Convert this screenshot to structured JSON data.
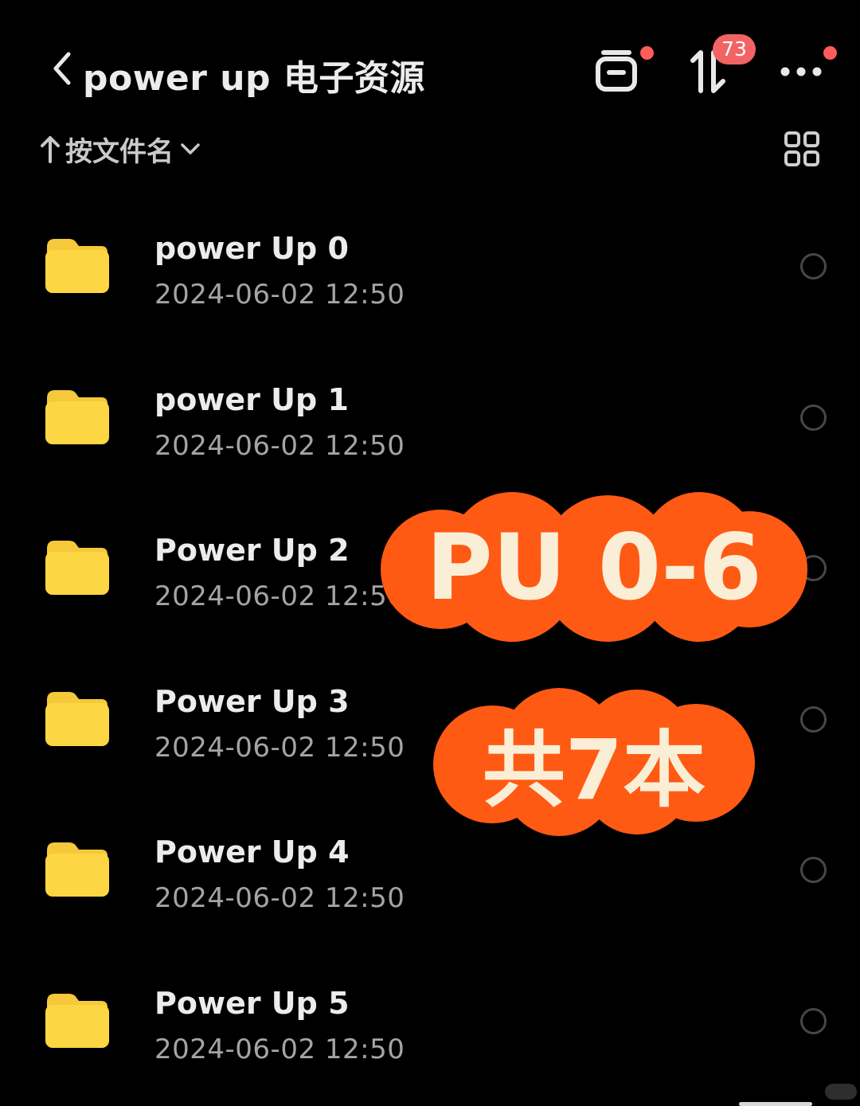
{
  "header": {
    "title": "power up 电子资源",
    "transfer_badge": "73"
  },
  "sort": {
    "label": "按文件名"
  },
  "files": [
    {
      "name": "power Up 0",
      "date": "2024-06-02 12:50"
    },
    {
      "name": "power Up 1",
      "date": "2024-06-02 12:50"
    },
    {
      "name": "Power Up 2",
      "date": "2024-06-02 12:50"
    },
    {
      "name": "Power Up 3",
      "date": "2024-06-02 12:50"
    },
    {
      "name": "Power Up 4",
      "date": "2024-06-02 12:50"
    },
    {
      "name": "Power Up 5",
      "date": "2024-06-02 12:50"
    }
  ],
  "overlay": {
    "headline": "PU 0-6",
    "count": "共7本"
  },
  "colors": {
    "background": "#000000",
    "folder": "#fdd643",
    "sticker": "#ff5a14",
    "sticker_text": "#fbeed6",
    "badge": "#f26464"
  }
}
